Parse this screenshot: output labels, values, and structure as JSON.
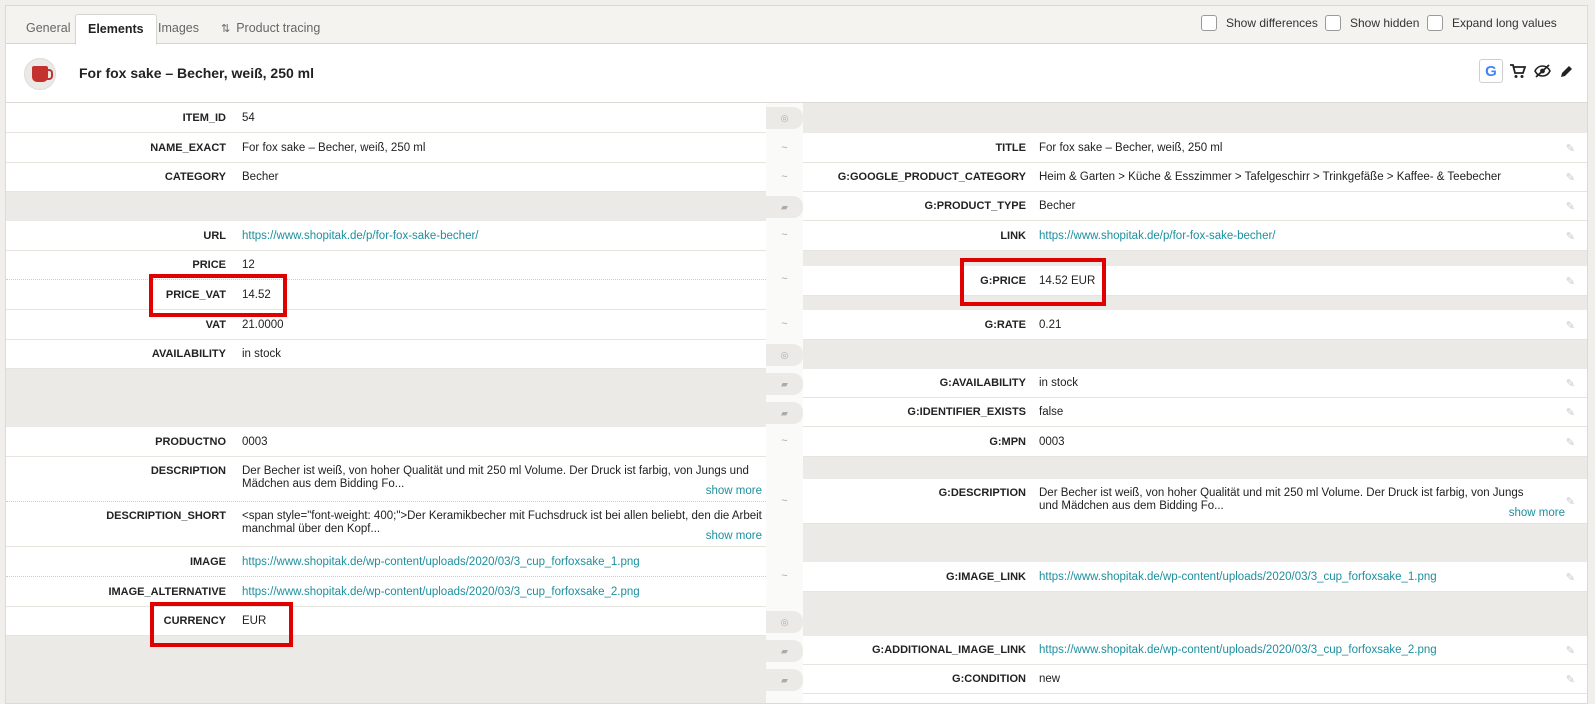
{
  "tabs": [
    "General",
    "Elements",
    "Images",
    "Product tracing"
  ],
  "options": [
    "Show differences",
    "Show hidden",
    "Expand long values"
  ],
  "product_title": "For fox sake – Becher, weiß, 250 ml",
  "show_more": "show more",
  "left": {
    "item_id": {
      "key": "ITEM_ID",
      "value": "54"
    },
    "name_exact": {
      "key": "NAME_EXACT",
      "value": "For fox sake – Becher, weiß, 250 ml"
    },
    "category": {
      "key": "CATEGORY",
      "value": "Becher"
    },
    "url": {
      "key": "URL",
      "value": "https://www.shopitak.de/p/for-fox-sake-becher/"
    },
    "price": {
      "key": "PRICE",
      "value": "12"
    },
    "price_vat": {
      "key": "PRICE_VAT",
      "value": "14.52"
    },
    "vat": {
      "key": "VAT",
      "value": "21.0000"
    },
    "availability": {
      "key": "AVAILABILITY",
      "value": "in stock"
    },
    "productno": {
      "key": "PRODUCTNO",
      "value": "0003"
    },
    "description": {
      "key": "DESCRIPTION",
      "value": "Der Becher ist weiß, von hoher Qualität und mit 250 ml Volume. Der Druck ist farbig, von Jungs und Mädchen aus dem Bidding Fo..."
    },
    "description_short": {
      "key": "DESCRIPTION_SHORT",
      "value": "<span style=\"font-weight: 400;\">Der Keramikbecher mit Fuchsdruck ist bei allen beliebt, den die Arbeit manchmal über den Kopf..."
    },
    "image": {
      "key": "IMAGE",
      "value": "https://www.shopitak.de/wp-content/uploads/2020/03/3_cup_forfoxsake_1.png"
    },
    "image_alternative": {
      "key": "IMAGE_ALTERNATIVE",
      "value": "https://www.shopitak.de/wp-content/uploads/2020/03/3_cup_forfoxsake_2.png"
    },
    "currency": {
      "key": "CURRENCY",
      "value": "EUR"
    }
  },
  "right": {
    "title": {
      "key": "TITLE",
      "value": "For fox sake – Becher, weiß, 250 ml"
    },
    "google_product_category": {
      "key": "G:GOOGLE_PRODUCT_CATEGORY",
      "value": "Heim & Garten > Küche & Esszimmer > Tafelgeschirr > Trinkgefäße > Kaffee- & Teebecher"
    },
    "product_type": {
      "key": "G:PRODUCT_TYPE",
      "value": "Becher"
    },
    "link": {
      "key": "LINK",
      "value": "https://www.shopitak.de/p/for-fox-sake-becher/"
    },
    "price": {
      "key": "G:PRICE",
      "value": "14.52 EUR"
    },
    "rate": {
      "key": "G:RATE",
      "value": "0.21"
    },
    "availability": {
      "key": "G:AVAILABILITY",
      "value": "in stock"
    },
    "identifier_exists": {
      "key": "G:IDENTIFIER_EXISTS",
      "value": "false"
    },
    "mpn": {
      "key": "G:MPN",
      "value": "0003"
    },
    "description": {
      "key": "G:DESCRIPTION",
      "value": "Der Becher ist weiß, von hoher Qualität und mit 250 ml Volume. Der Druck ist farbig, von Jungs und Mädchen aus dem Bidding Fo..."
    },
    "image_link": {
      "key": "G:IMAGE_LINK",
      "value": "https://www.shopitak.de/wp-content/uploads/2020/03/3_cup_forfoxsake_1.png"
    },
    "additional_image_link": {
      "key": "G:ADDITIONAL_IMAGE_LINK",
      "value": "https://www.shopitak.de/wp-content/uploads/2020/03/3_cup_forfoxsake_2.png"
    },
    "condition": {
      "key": "G:CONDITION",
      "value": "new"
    }
  },
  "mid_marks": {
    "tilde": "~"
  },
  "icons": [
    "google-icon",
    "cart-icon",
    "hidden-eye-icon",
    "pencil-icon"
  ],
  "colors": {
    "link": "#1d8f9e",
    "highlight": "#e00000",
    "google": "#4285f4"
  }
}
